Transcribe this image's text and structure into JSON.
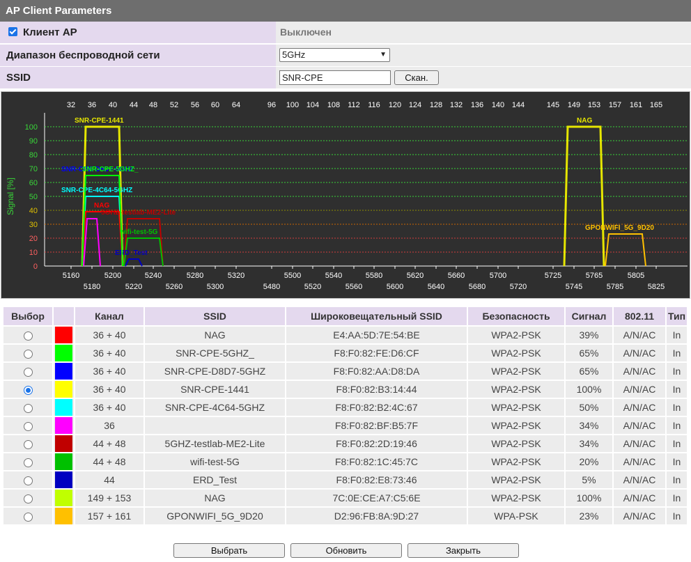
{
  "title": "AP Client Parameters",
  "params": {
    "client_label": "Клиент AP",
    "client_checked": true,
    "client_state": "Выключен",
    "band_label": "Диапазон беспроводной сети",
    "band_value": "5GHz",
    "ssid_label": "SSID",
    "ssid_value": "SNR-CPE",
    "scan_button": "Скан."
  },
  "chart_data": {
    "type": "area",
    "ylabel": "Signal [%]",
    "ylim": [
      0,
      100
    ],
    "yticks": [
      0,
      10,
      20,
      30,
      40,
      50,
      60,
      70,
      80,
      90,
      100
    ],
    "channel_ticks": [
      "32",
      "36",
      "40",
      "44",
      "48",
      "52",
      "56",
      "60",
      "64",
      "96",
      "100",
      "104",
      "108",
      "112",
      "116",
      "120",
      "124",
      "128",
      "132",
      "136",
      "140",
      "144",
      "145",
      "149",
      "153",
      "157",
      "161",
      "165"
    ],
    "freq_ticks_top": [
      "5160",
      "5200",
      "5240",
      "5280",
      "5320",
      "5500",
      "5540",
      "5580",
      "5620",
      "5660",
      "5700",
      "5725",
      "5765",
      "5805"
    ],
    "freq_ticks_bottom": [
      "5180",
      "5220",
      "5260",
      "5300",
      "5480",
      "5520",
      "5560",
      "5600",
      "5640",
      "5680",
      "5720",
      "5745",
      "5785",
      "5825"
    ],
    "series": [
      {
        "name": "SNR-CPE-1441",
        "channel": "36 + 40",
        "signal": 100,
        "color": "#e6e600"
      },
      {
        "name": "NAG",
        "channel": "149 + 153",
        "signal": 100,
        "color": "#e6e600"
      },
      {
        "name": "SNR-CPE-D8D7-5GHZ",
        "channel": "36 + 40",
        "signal": 65,
        "color": "#0000ff"
      },
      {
        "name": "SNR-CPE-4C64-5GHZ",
        "channel": "36 + 40",
        "signal": 50,
        "color": "#00ffff"
      },
      {
        "name": "NAG",
        "channel": "36 + 40",
        "signal": 39,
        "color": "#ff0000"
      },
      {
        "name": "5GHZ-testlab-ME2-Lite",
        "channel": "44 + 48",
        "signal": 34,
        "color": "#c00000"
      },
      {
        "name": "wifi-test-5G",
        "channel": "44 + 48",
        "signal": 20,
        "color": "#00c000"
      },
      {
        "name": "ERD_Test",
        "channel": "44",
        "signal": 5,
        "color": "#0000c0"
      },
      {
        "name": "GPONWIFI_5G_9D20",
        "channel": "157 + 161",
        "signal": 23,
        "color": "#ffc000"
      },
      {
        "name": "",
        "channel": "36",
        "signal": 34,
        "color": "#ff00ff"
      },
      {
        "name": "SNR-CPE-5GHZ_",
        "channel": "36 + 40",
        "signal": 65,
        "color": "#00ff00"
      }
    ]
  },
  "table": {
    "headers": [
      "Выбор",
      "",
      "Канал",
      "SSID",
      "Широковещательный SSID",
      "Безопасность",
      "Сигнал",
      "802.11",
      "Тип"
    ],
    "rows": [
      {
        "selected": false,
        "color": "#ff0000",
        "channel": "36 + 40",
        "ssid": "NAG",
        "bssid": "E4:AA:5D:7E:54:BE",
        "security": "WPA2-PSK",
        "signal": "39%",
        "mode": "A/N/AC",
        "type": "In"
      },
      {
        "selected": false,
        "color": "#00ff00",
        "channel": "36 + 40",
        "ssid": "SNR-CPE-5GHZ_",
        "bssid": "F8:F0:82:FE:D6:CF",
        "security": "WPA2-PSK",
        "signal": "65%",
        "mode": "A/N/AC",
        "type": "In"
      },
      {
        "selected": false,
        "color": "#0000ff",
        "channel": "36 + 40",
        "ssid": "SNR-CPE-D8D7-5GHZ",
        "bssid": "F8:F0:82:AA:D8:DA",
        "security": "WPA2-PSK",
        "signal": "65%",
        "mode": "A/N/AC",
        "type": "In"
      },
      {
        "selected": true,
        "color": "#ffff00",
        "channel": "36 + 40",
        "ssid": "SNR-CPE-1441",
        "bssid": "F8:F0:82:B3:14:44",
        "security": "WPA2-PSK",
        "signal": "100%",
        "mode": "A/N/AC",
        "type": "In"
      },
      {
        "selected": false,
        "color": "#00ffff",
        "channel": "36 + 40",
        "ssid": "SNR-CPE-4C64-5GHZ",
        "bssid": "F8:F0:82:B2:4C:67",
        "security": "WPA2-PSK",
        "signal": "50%",
        "mode": "A/N/AC",
        "type": "In"
      },
      {
        "selected": false,
        "color": "#ff00ff",
        "channel": "36",
        "ssid": "",
        "bssid": "F8:F0:82:BF:B5:7F",
        "security": "WPA2-PSK",
        "signal": "34%",
        "mode": "A/N/AC",
        "type": "In"
      },
      {
        "selected": false,
        "color": "#c00000",
        "channel": "44 + 48",
        "ssid": "5GHZ-testlab-ME2-Lite",
        "bssid": "F8:F0:82:2D:19:46",
        "security": "WPA2-PSK",
        "signal": "34%",
        "mode": "A/N/AC",
        "type": "In"
      },
      {
        "selected": false,
        "color": "#00c000",
        "channel": "44 + 48",
        "ssid": "wifi-test-5G",
        "bssid": "F8:F0:82:1C:45:7C",
        "security": "WPA2-PSK",
        "signal": "20%",
        "mode": "A/N/AC",
        "type": "In"
      },
      {
        "selected": false,
        "color": "#0000c0",
        "channel": "44",
        "ssid": "ERD_Test",
        "bssid": "F8:F0:82:E8:73:46",
        "security": "WPA2-PSK",
        "signal": "5%",
        "mode": "A/N/AC",
        "type": "In"
      },
      {
        "selected": false,
        "color": "#c0ff00",
        "channel": "149 + 153",
        "ssid": "NAG",
        "bssid": "7C:0E:CE:A7:C5:6E",
        "security": "WPA2-PSK",
        "signal": "100%",
        "mode": "A/N/AC",
        "type": "In"
      },
      {
        "selected": false,
        "color": "#ffc000",
        "channel": "157 + 161",
        "ssid": "GPONWIFI_5G_9D20",
        "bssid": "D2:96:FB:8A:9D:27",
        "security": "WPA-PSK",
        "signal": "23%",
        "mode": "A/N/AC",
        "type": "In"
      }
    ]
  },
  "buttons": {
    "select": "Выбрать",
    "refresh": "Обновить",
    "close": "Закрыть"
  },
  "colors": {
    "title_bg": "#6e6e6e",
    "label_bg": "#e4d9ee",
    "value_bg": "#ececec",
    "chart_bg": "#2f2f2f"
  }
}
